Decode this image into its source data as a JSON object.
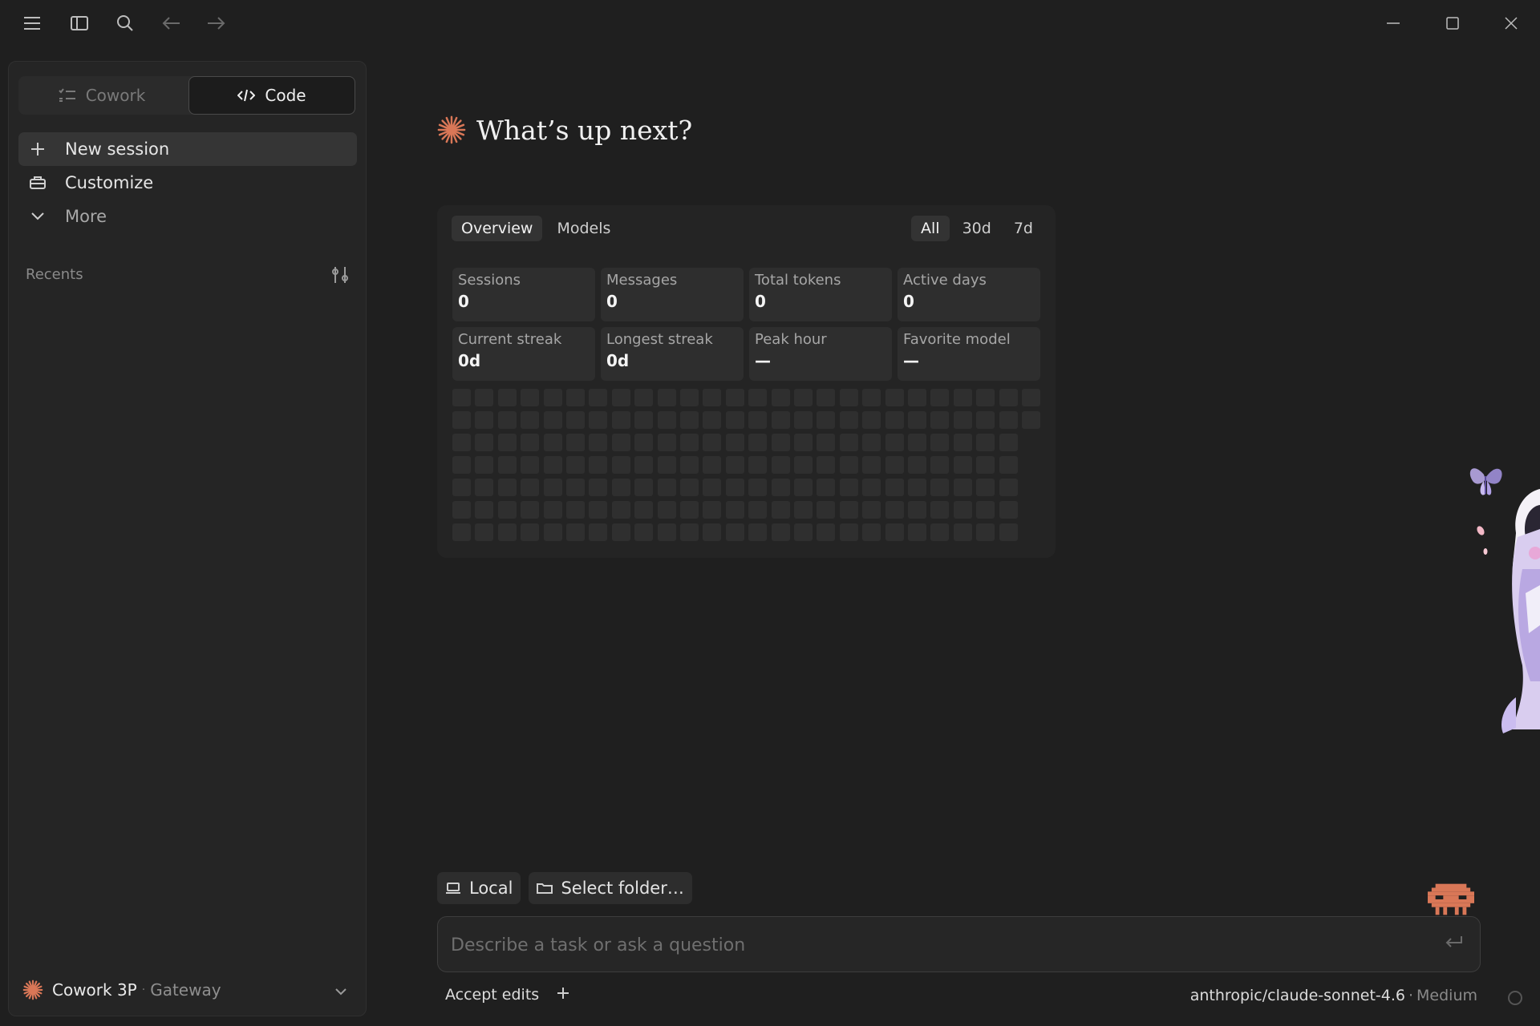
{
  "window": {
    "menu_icon": "hamburger-icon",
    "panel_icon": "sidebar-toggle-icon",
    "search_icon": "search-icon",
    "back_icon": "arrow-left-icon",
    "forward_icon": "arrow-right-icon",
    "controls": [
      "minimize-icon",
      "maximize-icon",
      "close-icon"
    ]
  },
  "sidebar": {
    "modes": [
      {
        "label": "Cowork",
        "icon": "checklist-icon",
        "selected": false
      },
      {
        "label": "Code",
        "icon": "code-icon",
        "selected": true
      }
    ],
    "nav": [
      {
        "label": "New session",
        "icon": "plus-icon"
      },
      {
        "label": "Customize",
        "icon": "toolbox-icon"
      },
      {
        "label": "More",
        "icon": "chevron-down-icon"
      }
    ],
    "recents_label": "Recents",
    "account": {
      "name": "Cowork 3P",
      "separator": "·",
      "provider": "Gateway"
    }
  },
  "main": {
    "heading": "What’s up next?",
    "stats": {
      "tabs": [
        "Overview",
        "Models"
      ],
      "active_tab": "Overview",
      "ranges": [
        "All",
        "30d",
        "7d"
      ],
      "active_range": "All",
      "cards": [
        {
          "label": "Sessions",
          "value": "0"
        },
        {
          "label": "Messages",
          "value": "0"
        },
        {
          "label": "Total tokens",
          "value": "0"
        },
        {
          "label": "Active days",
          "value": "0"
        },
        {
          "label": "Current streak",
          "value": "0d"
        },
        {
          "label": "Longest streak",
          "value": "0d"
        },
        {
          "label": "Peak hour",
          "value": "—"
        },
        {
          "label": "Favorite model",
          "value": "—"
        }
      ]
    },
    "composer": {
      "chips": [
        {
          "label": "Local",
          "icon": "laptop-icon"
        },
        {
          "label": "Select folder…",
          "icon": "folder-icon"
        }
      ],
      "placeholder": "Describe a task or ask a question",
      "mode_label": "Accept edits",
      "model": "anthropic/claude-sonnet-4.6",
      "separator": "·",
      "effort": "Medium"
    }
  },
  "colors": {
    "background": "#1f1f1f",
    "sidebar": "#252525",
    "accent": "#d97757",
    "heatmap_cell": "#2f2f2f"
  }
}
